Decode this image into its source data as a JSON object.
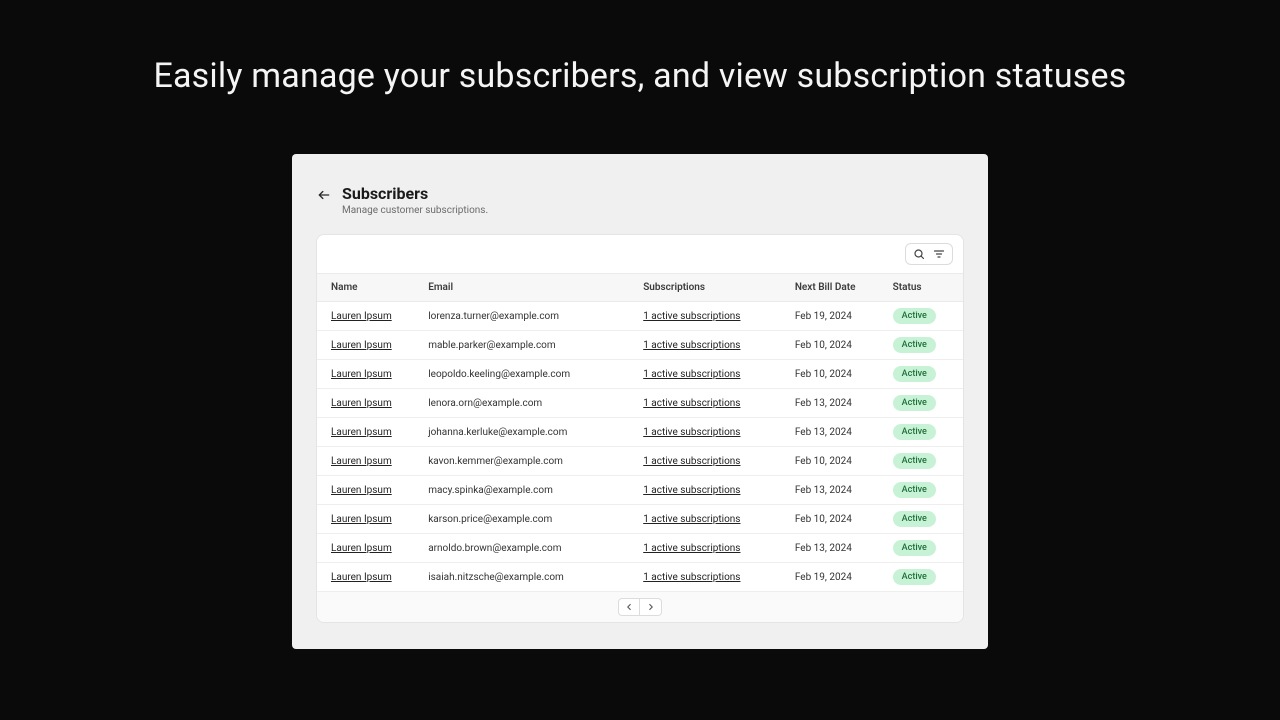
{
  "hero": "Easily manage your subscribers, and view subscription statuses",
  "header": {
    "title": "Subscribers",
    "subtitle": "Manage customer subscriptions."
  },
  "columns": {
    "name": "Name",
    "email": "Email",
    "subs": "Subscriptions",
    "next": "Next Bill Date",
    "status": "Status"
  },
  "rows": [
    {
      "name": "Lauren Ipsum",
      "email": "lorenza.turner@example.com",
      "subs": "1 active subscriptions",
      "next": "Feb 19, 2024",
      "status": "Active"
    },
    {
      "name": "Lauren Ipsum",
      "email": "mable.parker@example.com",
      "subs": "1 active subscriptions",
      "next": "Feb 10, 2024",
      "status": "Active"
    },
    {
      "name": "Lauren Ipsum",
      "email": "leopoldo.keeling@example.com",
      "subs": "1 active subscriptions",
      "next": "Feb 10, 2024",
      "status": "Active"
    },
    {
      "name": "Lauren Ipsum",
      "email": "lenora.orn@example.com",
      "subs": "1 active subscriptions",
      "next": "Feb 13, 2024",
      "status": "Active"
    },
    {
      "name": "Lauren Ipsum",
      "email": "johanna.kerluke@example.com",
      "subs": "1 active subscriptions",
      "next": "Feb 13, 2024",
      "status": "Active"
    },
    {
      "name": "Lauren Ipsum",
      "email": "kavon.kemmer@example.com",
      "subs": "1 active subscriptions",
      "next": "Feb 10, 2024",
      "status": "Active"
    },
    {
      "name": "Lauren Ipsum",
      "email": "macy.spinka@example.com",
      "subs": "1 active subscriptions",
      "next": "Feb 13, 2024",
      "status": "Active"
    },
    {
      "name": "Lauren Ipsum",
      "email": "karson.price@example.com",
      "subs": "1 active subscriptions",
      "next": "Feb 10, 2024",
      "status": "Active"
    },
    {
      "name": "Lauren Ipsum",
      "email": "arnoldo.brown@example.com",
      "subs": "1 active subscriptions",
      "next": "Feb 13, 2024",
      "status": "Active"
    },
    {
      "name": "Lauren Ipsum",
      "email": "isaiah.nitzsche@example.com",
      "subs": "1 active subscriptions",
      "next": "Feb 19, 2024",
      "status": "Active"
    }
  ]
}
